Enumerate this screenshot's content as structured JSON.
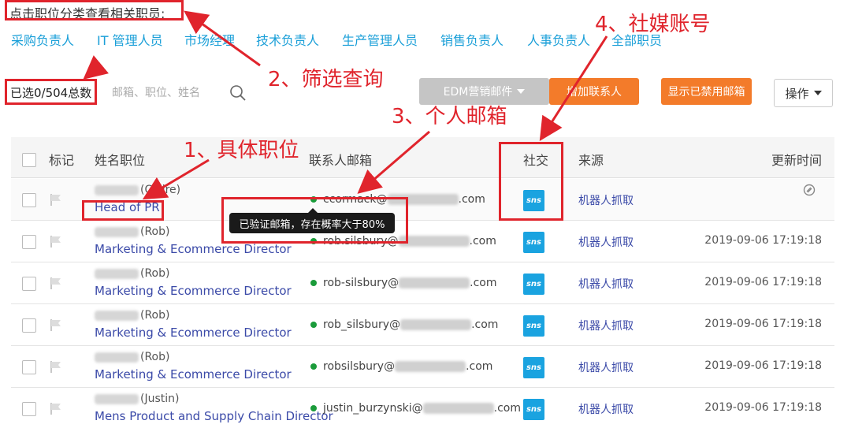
{
  "hint": "点击职位分类查看相关职员:",
  "categories": [
    "采购负责人",
    "IT 管理人员",
    "市场经理",
    "技术负责人",
    "生产管理人员",
    "销售负责人",
    "人事负责人",
    "全部职员"
  ],
  "count_text": "已选0/504总数",
  "search": {
    "placeholder": "邮箱、职位、姓名",
    "icon": "search-icon"
  },
  "buttons": {
    "edm": "EDM营销邮件",
    "add_contact": "增加联系人",
    "show_disabled": "显示已禁用邮箱",
    "ops": "操作"
  },
  "table": {
    "headers": {
      "mark": "标记",
      "name": "姓名职位",
      "email": "联系人邮箱",
      "social": "社交",
      "source": "来源",
      "updated": "更新时间"
    },
    "rows": [
      {
        "name_suffix": "(Claire)",
        "title": "Head of PR",
        "email_prefix": "ccormack@",
        "email_suffix": ".com",
        "social": "sns",
        "source": "机器人抓取",
        "updated": ""
      },
      {
        "name_suffix": "(Rob)",
        "title": "Marketing & Ecommerce Director",
        "email_prefix": "rob.silsbury@",
        "email_suffix": ".com",
        "social": "sns",
        "source": "机器人抓取",
        "updated": "2019-09-06 17:19:18"
      },
      {
        "name_suffix": "(Rob)",
        "title": "Marketing & Ecommerce Director",
        "email_prefix": "rob-silsbury@",
        "email_suffix": ".com",
        "social": "sns",
        "source": "机器人抓取",
        "updated": "2019-09-06 17:19:18"
      },
      {
        "name_suffix": "(Rob)",
        "title": "Marketing & Ecommerce Director",
        "email_prefix": "rob_silsbury@",
        "email_suffix": ".com",
        "social": "sns",
        "source": "机器人抓取",
        "updated": "2019-09-06 17:19:18"
      },
      {
        "name_suffix": "(Rob)",
        "title": "Marketing & Ecommerce Director",
        "email_prefix": "robsilsbury@",
        "email_suffix": ".com",
        "social": "sns",
        "source": "机器人抓取",
        "updated": "2019-09-06 17:19:18"
      },
      {
        "name_suffix": "(Justin)",
        "title": "Mens Product and Supply Chain Director",
        "email_prefix": "justin_burzynski@",
        "email_suffix": ".com",
        "social": "sns",
        "source": "机器人抓取",
        "updated": "2019-09-06 17:19:18"
      }
    ]
  },
  "tooltip": "已验证邮箱，存在概率大于80%",
  "annotations": {
    "a1": "1、具体职位",
    "a2": "2、筛选查询",
    "a3": "3、个人邮箱",
    "a4": "4、社媒账号"
  },
  "colors": {
    "accent": "#f37b2a",
    "link": "#1a9fd8",
    "annotation": "#e0242c",
    "verified": "#1a9b3a",
    "sns": "#1aa3e0"
  }
}
